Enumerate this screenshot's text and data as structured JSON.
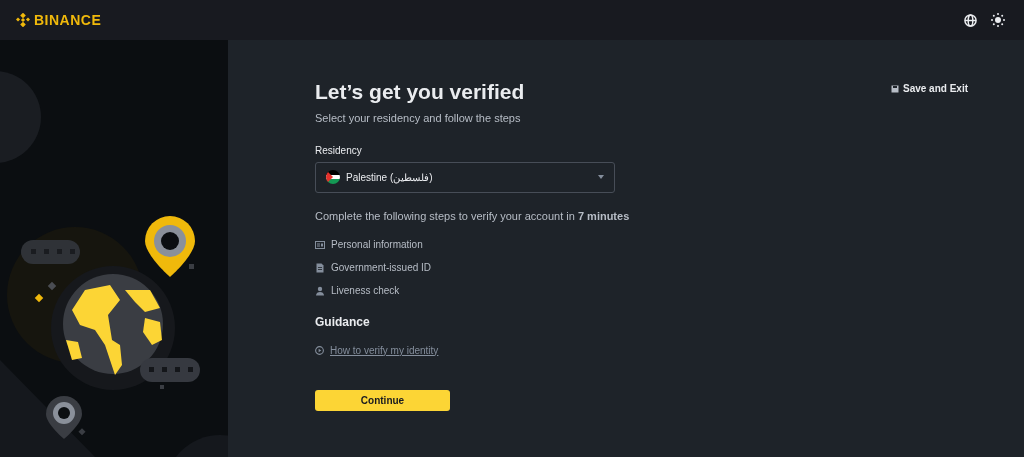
{
  "header": {
    "logo": "BINANCE"
  },
  "save_exit": "Save and Exit",
  "title": "Let’s get you verified",
  "subtitle": "Select your residency and follow the steps",
  "residency": {
    "label": "Residency",
    "value": "Palestine (فلسطين)"
  },
  "steps_intro": "Complete the following steps to verify your account in **7 minutes**",
  "steps": [
    {
      "kind": "card",
      "label": "Personal information"
    },
    {
      "kind": "document",
      "label": "Government-issued ID"
    },
    {
      "kind": "person",
      "label": "Liveness check"
    }
  ],
  "guidance": {
    "title": "Guidance",
    "link": "How to verify my identity"
  },
  "continue": "Continue"
}
